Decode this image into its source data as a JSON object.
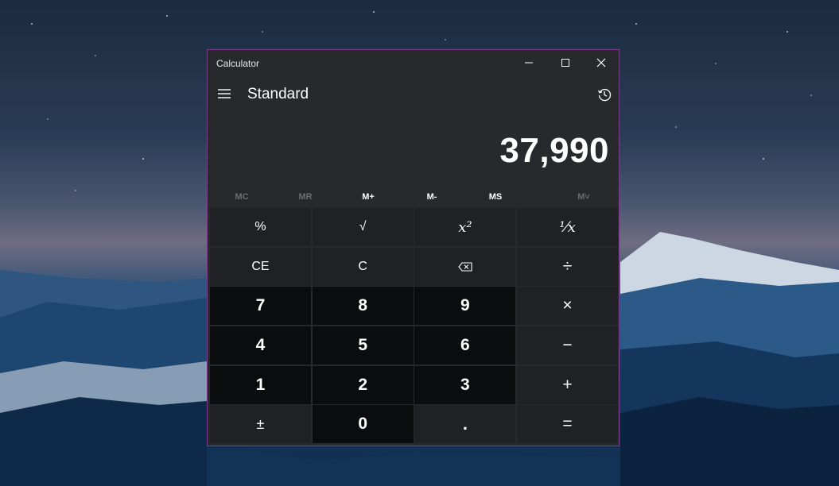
{
  "window": {
    "title": "Calculator"
  },
  "header": {
    "mode": "Standard"
  },
  "display": {
    "value": "37,990"
  },
  "memory": [
    {
      "label": "MC",
      "enabled": false
    },
    {
      "label": "MR",
      "enabled": false
    },
    {
      "label": "M+",
      "enabled": true
    },
    {
      "label": "M-",
      "enabled": true
    },
    {
      "label": "MS",
      "enabled": true
    },
    {
      "label": "M˅",
      "enabled": false
    }
  ],
  "keys": {
    "percent": "%",
    "sqrt": "√",
    "square": "x²",
    "reciprocal": "¹⁄x",
    "ce": "CE",
    "c": "C",
    "divide": "÷",
    "seven": "7",
    "eight": "8",
    "nine": "9",
    "multiply": "×",
    "four": "4",
    "five": "5",
    "six": "6",
    "minus": "−",
    "one": "1",
    "two": "2",
    "three": "3",
    "plus": "+",
    "negate": "±",
    "zero": "0",
    "decimal": ".",
    "equals": "="
  },
  "icons": {
    "menu": "hamburger-icon",
    "history": "history-icon",
    "backspace": "backspace-icon",
    "minimize": "minimize-icon",
    "maximize": "maximize-icon",
    "close": "close-icon"
  },
  "colors": {
    "window_border": "#7a3d8a",
    "window_bg": "#27292d",
    "number_key_bg": "#0b0c0e",
    "function_key_bg": "#1f2125"
  }
}
